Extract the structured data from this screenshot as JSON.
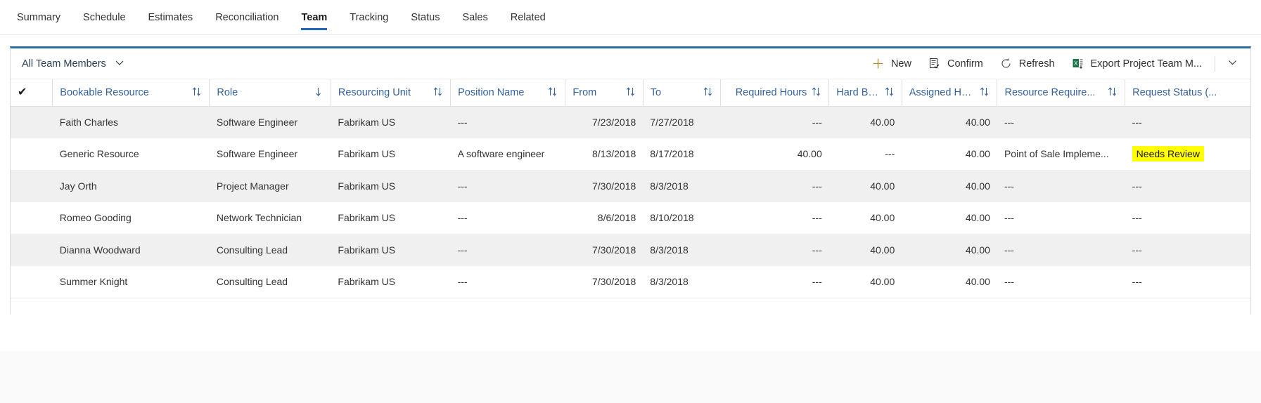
{
  "tabs": [
    {
      "label": "Summary",
      "active": false
    },
    {
      "label": "Schedule",
      "active": false
    },
    {
      "label": "Estimates",
      "active": false
    },
    {
      "label": "Reconciliation",
      "active": false
    },
    {
      "label": "Team",
      "active": true
    },
    {
      "label": "Tracking",
      "active": false
    },
    {
      "label": "Status",
      "active": false
    },
    {
      "label": "Sales",
      "active": false
    },
    {
      "label": "Related",
      "active": false
    }
  ],
  "commandbar": {
    "view_name": "All Team Members",
    "view_chevron": "chevron-down-icon",
    "buttons": [
      {
        "label": "New",
        "icon": "plus-icon"
      },
      {
        "label": "Confirm",
        "icon": "confirm-list-icon"
      },
      {
        "label": "Refresh",
        "icon": "refresh-icon"
      },
      {
        "label": "Export Project Team M...",
        "icon": "excel-export-icon"
      }
    ],
    "overflow_icon": "chevron-down-icon"
  },
  "grid": {
    "select_all_glyph": "✔",
    "columns": [
      {
        "label": "Bookable Resource",
        "sort": "unsorted",
        "align": "left"
      },
      {
        "label": "Role",
        "sort": "desc",
        "align": "left"
      },
      {
        "label": "Resourcing Unit",
        "sort": "unsorted",
        "align": "left"
      },
      {
        "label": "Position Name",
        "sort": "unsorted",
        "align": "left"
      },
      {
        "label": "From",
        "sort": "unsorted",
        "align": "left"
      },
      {
        "label": "To",
        "sort": "unsorted",
        "align": "left"
      },
      {
        "label": "Required Hours",
        "sort": "unsorted",
        "align": "right"
      },
      {
        "label": "Hard Boo...",
        "sort": "unsorted",
        "align": "right"
      },
      {
        "label": "Assigned Hours",
        "sort": "unsorted",
        "align": "right"
      },
      {
        "label": "Resource Require...",
        "sort": "unsorted",
        "align": "left"
      },
      {
        "label": "Request Status (...",
        "sort": "none",
        "align": "left"
      }
    ],
    "rows": [
      {
        "bookable_resource": "Faith Charles",
        "role": "Software Engineer",
        "resourcing_unit": "Fabrikam US",
        "position_name": "---",
        "from": "7/23/2018",
        "to": "7/27/2018",
        "required_hours": "---",
        "hard_booked_hours": "40.00",
        "assigned_hours": "40.00",
        "resource_requirement": "---",
        "request_status": "---",
        "request_status_highlighted": false
      },
      {
        "bookable_resource": "Generic Resource",
        "role": "Software Engineer",
        "resourcing_unit": "Fabrikam US",
        "position_name": "A software engineer",
        "from": "8/13/2018",
        "to": "8/17/2018",
        "required_hours": "40.00",
        "hard_booked_hours": "---",
        "assigned_hours": "40.00",
        "resource_requirement": "Point of Sale Impleme...",
        "request_status": "Needs Review",
        "request_status_highlighted": true
      },
      {
        "bookable_resource": "Jay Orth",
        "role": "Project Manager",
        "resourcing_unit": "Fabrikam US",
        "position_name": "---",
        "from": "7/30/2018",
        "to": "8/3/2018",
        "required_hours": "---",
        "hard_booked_hours": "40.00",
        "assigned_hours": "40.00",
        "resource_requirement": "---",
        "request_status": "---",
        "request_status_highlighted": false
      },
      {
        "bookable_resource": "Romeo Gooding",
        "role": "Network Technician",
        "resourcing_unit": "Fabrikam US",
        "position_name": "---",
        "from": "8/6/2018",
        "to": "8/10/2018",
        "required_hours": "---",
        "hard_booked_hours": "40.00",
        "assigned_hours": "40.00",
        "resource_requirement": "---",
        "request_status": "---",
        "request_status_highlighted": false
      },
      {
        "bookable_resource": "Dianna Woodward",
        "role": "Consulting Lead",
        "resourcing_unit": "Fabrikam US",
        "position_name": "---",
        "from": "7/30/2018",
        "to": "8/3/2018",
        "required_hours": "---",
        "hard_booked_hours": "40.00",
        "assigned_hours": "40.00",
        "resource_requirement": "---",
        "request_status": "---",
        "request_status_highlighted": false
      },
      {
        "bookable_resource": "Summer Knight",
        "role": "Consulting Lead",
        "resourcing_unit": "Fabrikam US",
        "position_name": "---",
        "from": "7/30/2018",
        "to": "8/3/2018",
        "required_hours": "---",
        "hard_booked_hours": "40.00",
        "assigned_hours": "40.00",
        "resource_requirement": "---",
        "request_status": "---",
        "request_status_highlighted": false
      }
    ]
  },
  "colors": {
    "accent": "#2b6ca3",
    "link": "#2a5fa8",
    "header_link": "#36629b",
    "highlight": "#ffff00",
    "row_alt": "#f0f0f0"
  }
}
